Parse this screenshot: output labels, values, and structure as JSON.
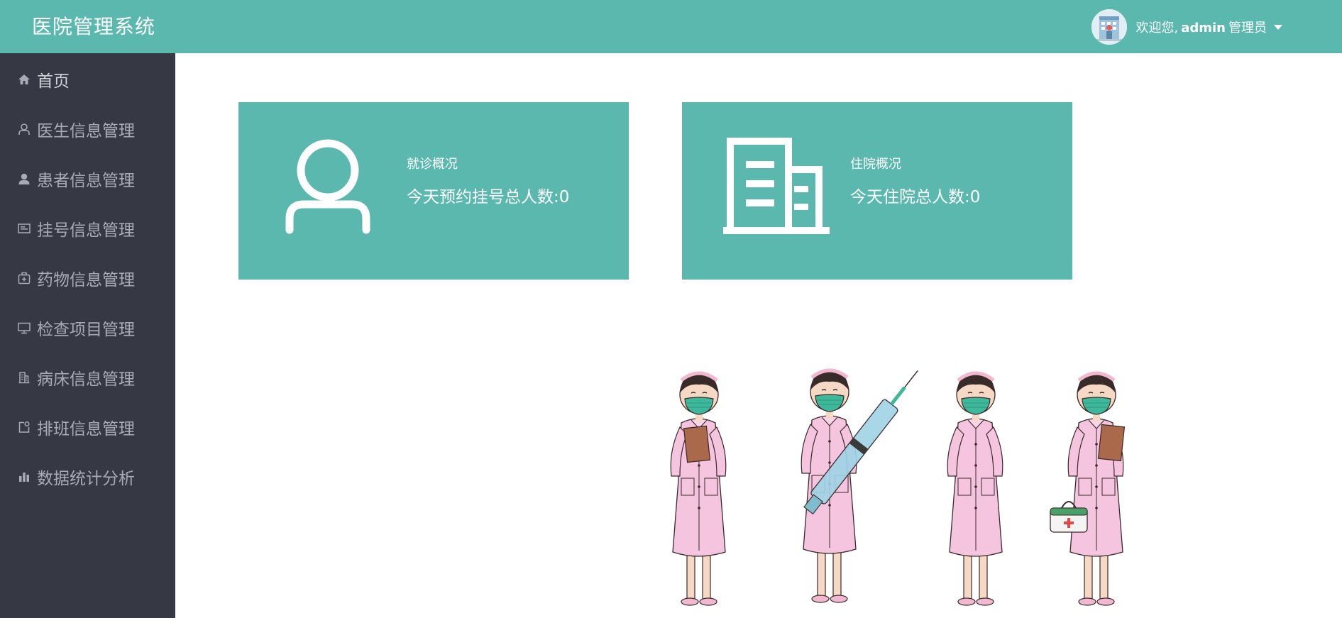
{
  "header": {
    "title": "医院管理系统",
    "welcome_prefix": "欢迎您,",
    "username": "admin",
    "role": "管理员"
  },
  "sidebar": {
    "items": [
      {
        "label": "首页",
        "icon": "home-icon"
      },
      {
        "label": "医生信息管理",
        "icon": "user-outline-icon"
      },
      {
        "label": "患者信息管理",
        "icon": "user-solid-icon"
      },
      {
        "label": "挂号信息管理",
        "icon": "id-card-icon"
      },
      {
        "label": "药物信息管理",
        "icon": "medicine-box-icon"
      },
      {
        "label": "检查项目管理",
        "icon": "monitor-icon"
      },
      {
        "label": "病床信息管理",
        "icon": "building-icon"
      },
      {
        "label": "排班信息管理",
        "icon": "schedule-icon"
      },
      {
        "label": "数据统计分析",
        "icon": "bar-chart-icon"
      }
    ]
  },
  "cards": [
    {
      "title": "就诊概况",
      "stat_label": "今天预约挂号总人数:",
      "value": "0",
      "icon": "user-outline-icon"
    },
    {
      "title": "住院概况",
      "stat_label": "今天住院总人数:",
      "value": "0",
      "icon": "building-icon"
    }
  ],
  "colors": {
    "primary": "#5ab8ae",
    "sidebar_bg": "#363844",
    "sidebar_text": "#a9abb4"
  }
}
